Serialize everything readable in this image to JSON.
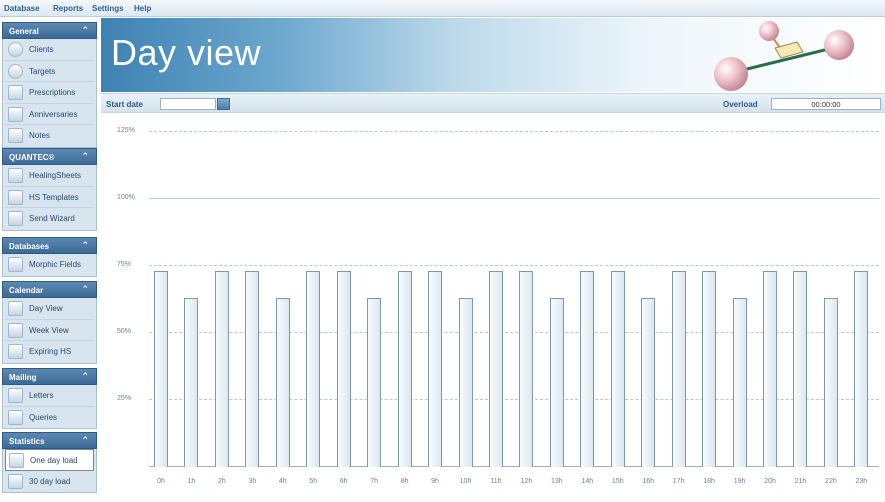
{
  "menu": [
    "Database",
    "Reports",
    "Settings",
    "Help"
  ],
  "sidebar": {
    "groups": [
      {
        "title": "General",
        "items": [
          {
            "label": "Clients",
            "icon": "clients-icon"
          },
          {
            "label": "Targets",
            "icon": "targets-icon"
          },
          {
            "label": "Prescriptions",
            "icon": "prescriptions-icon"
          },
          {
            "label": "Anniversaries",
            "icon": "anniversaries-icon"
          },
          {
            "label": "Notes",
            "icon": "notes-icon"
          }
        ]
      },
      {
        "title": "QUANTEC®",
        "items": [
          {
            "label": "HealingSheets",
            "icon": "healingsheets-icon"
          },
          {
            "label": "HS Templates",
            "icon": "hs-templates-icon"
          },
          {
            "label": "Send Wizard",
            "icon": "send-wizard-icon"
          }
        ]
      },
      {
        "title": "Databases",
        "items": [
          {
            "label": "Morphic Fields",
            "icon": "morphic-fields-icon"
          }
        ]
      },
      {
        "title": "Calendar",
        "items": [
          {
            "label": "Day View",
            "icon": "day-view-icon"
          },
          {
            "label": "Week View",
            "icon": "week-view-icon"
          },
          {
            "label": "Expiring HS",
            "icon": "expiring-hs-icon"
          }
        ]
      },
      {
        "title": "Mailing",
        "items": [
          {
            "label": "Letters",
            "icon": "letters-icon"
          },
          {
            "label": "Queries",
            "icon": "queries-icon"
          }
        ]
      },
      {
        "title": "Statistics",
        "items": [
          {
            "label": "One day load",
            "icon": "one-day-load-icon",
            "active": true
          },
          {
            "label": "30 day load",
            "icon": "thirty-day-load-icon"
          }
        ]
      }
    ],
    "collapse_icon": "double-chevron-up-icon"
  },
  "header": {
    "title": "Day view"
  },
  "datebar": {
    "start_date_label": "Start date",
    "start_date_value": "",
    "overload_label": "Overload",
    "overload_value": "00:00:00",
    "calendar_icon": "calendar-icon"
  },
  "chart_data": {
    "type": "bar",
    "categories": [
      "0h",
      "1h",
      "2h",
      "3h",
      "4h",
      "5h",
      "6h",
      "7h",
      "8h",
      "9h",
      "10h",
      "11h",
      "12h",
      "13h",
      "14h",
      "15h",
      "16h",
      "17h",
      "18h",
      "19h",
      "20h",
      "21h",
      "22h",
      "23h"
    ],
    "values": [
      73,
      63,
      73,
      73,
      63,
      73,
      73,
      63,
      73,
      73,
      63,
      73,
      73,
      63,
      73,
      73,
      63,
      73,
      73,
      63,
      73,
      73,
      63,
      73
    ],
    "yticks": [
      "125%",
      "100%",
      "75%",
      "50%",
      "25%"
    ],
    "ylim": [
      0,
      125
    ],
    "grid": true
  }
}
